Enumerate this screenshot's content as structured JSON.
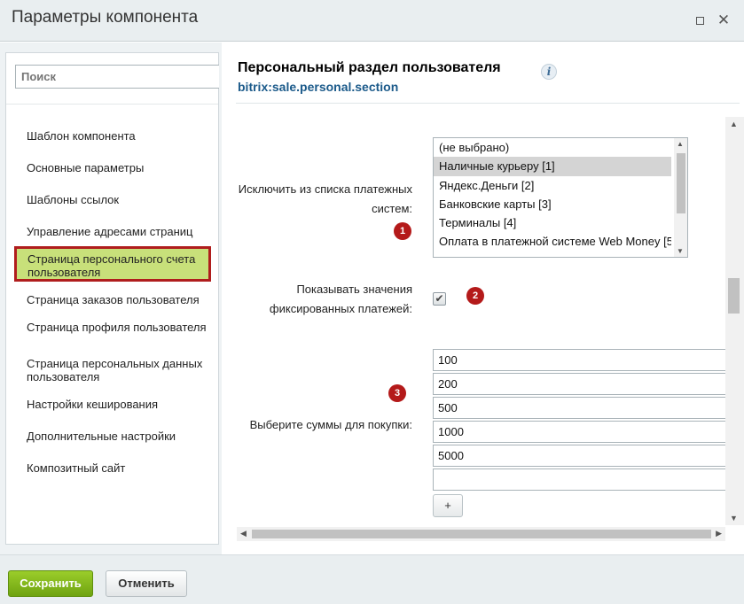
{
  "window": {
    "title": "Параметры компонента",
    "maximize_icon": "maximize-icon",
    "close_icon": "close-icon",
    "close_glyph": "✕"
  },
  "sidebar": {
    "search_placeholder": "Поиск",
    "items": [
      {
        "label": "Шаблон компонента",
        "active": false
      },
      {
        "label": "Основные параметры",
        "active": false
      },
      {
        "label": "Шаблоны ссылок",
        "active": false
      },
      {
        "label": "Управление адресами страниц",
        "active": false
      },
      {
        "label": "Страница персонального счета пользователя",
        "active": true
      },
      {
        "label": "Страница заказов пользователя",
        "active": false
      },
      {
        "label": "Страница профиля пользователя",
        "active": false
      },
      {
        "label": "Страница персональных данных пользователя",
        "active": false
      },
      {
        "label": "Настройки кеширования",
        "active": false
      },
      {
        "label": "Дополнительные настройки",
        "active": false
      },
      {
        "label": "Композитный сайт",
        "active": false
      }
    ],
    "active_border_color": "#b01d1d",
    "active_bg_color": "#c8e07a"
  },
  "main": {
    "heading": "Персональный раздел пользователя",
    "info_icon": "i",
    "component_code": "bitrix:sale.personal.section",
    "fields": {
      "exclude_paysystems": {
        "label": "Исключить из списка платежных систем:",
        "badge": "1",
        "options": [
          {
            "label": "(не выбрано)",
            "selected": false
          },
          {
            "label": "Наличные курьеру [1]",
            "selected": true
          },
          {
            "label": "Яндекс.Деньги [2]",
            "selected": false
          },
          {
            "label": "Банковские карты [3]",
            "selected": false
          },
          {
            "label": "Терминалы [4]",
            "selected": false
          },
          {
            "label": "Оплата в платежной системе Web Money [5",
            "selected": false
          }
        ]
      },
      "show_fixed_payments": {
        "label": "Показывать значения фиксированных платежей:",
        "badge": "2",
        "checked": true,
        "check_glyph": "✔"
      },
      "purchase_amounts": {
        "label": "Выберите суммы для покупки:",
        "badge": "3",
        "values": [
          "100",
          "200",
          "500",
          "1000",
          "5000",
          ""
        ],
        "add_label": "+"
      }
    },
    "badge_color": "#b41a1a"
  },
  "footer": {
    "save_label": "Сохранить",
    "cancel_label": "Отменить",
    "save_color": "#7cb518"
  }
}
